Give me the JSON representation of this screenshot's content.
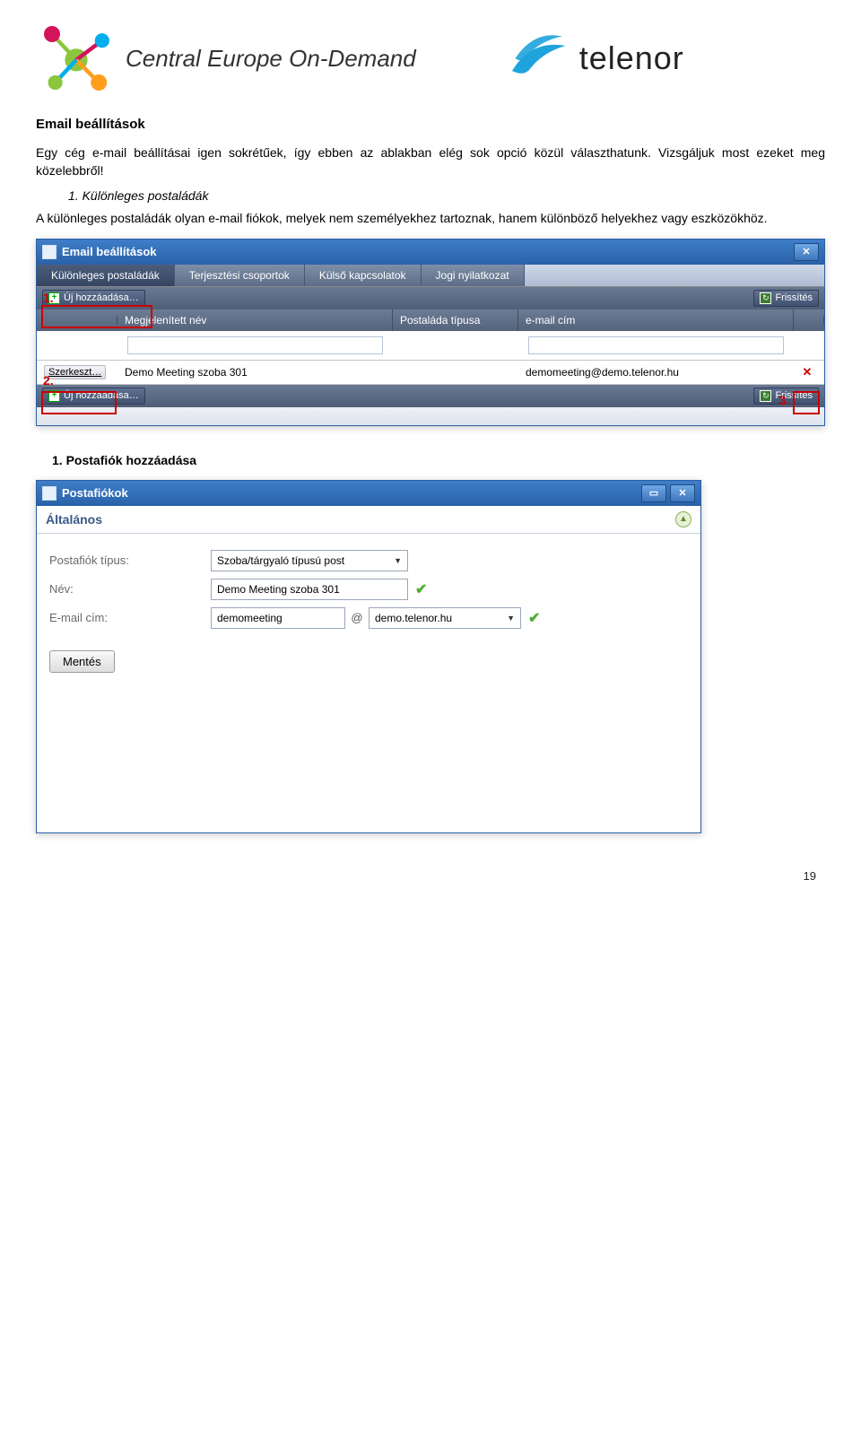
{
  "header": {
    "ceod_text": "Central Europe On-Demand",
    "telenor_text": "telenor"
  },
  "doc": {
    "title": "Email beállítások",
    "intro": "Egy cég e-mail beállításai igen sokrétűek, így ebben az ablakban elég sok opció közül választhatunk. Vizsgáljuk most ezeket meg közelebbről!",
    "item1_num": "1.",
    "item1_label": "Különleges postaládák",
    "item1_desc": "A különleges postaládák olyan e-mail fiókok, melyek nem személyekhez tartoznak, hanem különböző helyekhez vagy eszközökhöz.",
    "sub_num": "1.",
    "sub_title": "Postafiók hozzáadása",
    "page_number": "19"
  },
  "window1": {
    "title": "Email beállítások",
    "tabs": [
      "Különleges postaládák",
      "Terjesztési csoportok",
      "Külső kapcsolatok",
      "Jogi nyilatkozat"
    ],
    "active_tab_index": 0,
    "add_label": "Új hozzáadása…",
    "refresh_label": "Frissítés",
    "columns": [
      "",
      "Megjelenített név",
      "Postaláda típusa",
      "e-mail cím",
      ""
    ],
    "rows": [
      {
        "edit": "Szerkeszt…",
        "name": "Demo Meeting szoba 301",
        "type": "",
        "email": "demomeeting@demo.telenor.hu"
      }
    ],
    "callouts": {
      "c1": "1.",
      "c2": "2.",
      "c3": "3."
    }
  },
  "window2": {
    "title": "Postafiókok",
    "section": "Általános",
    "fields": {
      "type_label": "Postafiók típus:",
      "type_value": "Szoba/tárgyaló típusú post",
      "name_label": "Név:",
      "name_value": "Demo Meeting szoba 301",
      "email_label": "E-mail cím:",
      "email_local": "demomeeting",
      "at": "@",
      "email_domain": "demo.telenor.hu"
    },
    "save_label": "Mentés"
  }
}
